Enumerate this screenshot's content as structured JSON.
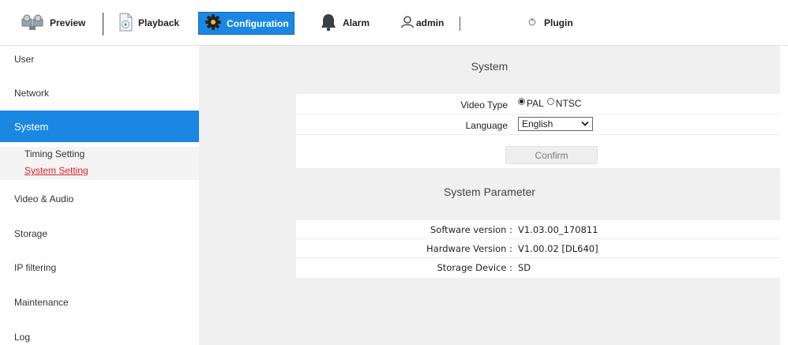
{
  "topbar": {
    "preview": {
      "label": "Preview",
      "icon": "camera-icon"
    },
    "playback": {
      "label": "Playback",
      "icon": "playback-file-icon"
    },
    "configuration": {
      "label": "Configuration",
      "icon": "gear-icon"
    },
    "alarm": {
      "label": "Alarm",
      "icon": "bell-icon"
    },
    "user": {
      "label": "admin",
      "icon": "user-icon"
    },
    "plugin": {
      "label": "Plugin",
      "icon": "plugin-icon"
    }
  },
  "sidebar": {
    "items": [
      {
        "label": "User"
      },
      {
        "label": "Network"
      },
      {
        "label": "System"
      },
      {
        "label": "Video & Audio"
      },
      {
        "label": "Storage"
      },
      {
        "label": "IP filtering"
      },
      {
        "label": "Maintenance"
      },
      {
        "label": "Log"
      }
    ],
    "sub_items": [
      {
        "label": "Timing Setting"
      },
      {
        "label": "System Setting"
      }
    ]
  },
  "system": {
    "title": "System",
    "video_type_label": "Video Type",
    "video_type_options": [
      "PAL",
      "NTSC"
    ],
    "video_type_selected": "PAL",
    "language_label": "Language",
    "language_value": "English",
    "confirm_label": "Confirm"
  },
  "params": {
    "title": "System Parameter",
    "rows": [
      {
        "label": "Software version :",
        "value": "V1.03.00_170811"
      },
      {
        "label": "Hardware Version :",
        "value": "V1.00.02 [DL640]"
      },
      {
        "label": "Storage Device :",
        "value": "SD"
      }
    ]
  },
  "colors": {
    "accent": "#1a88e2",
    "selected_sub": "#d8222a",
    "content_bg": "#f0f0f0"
  }
}
